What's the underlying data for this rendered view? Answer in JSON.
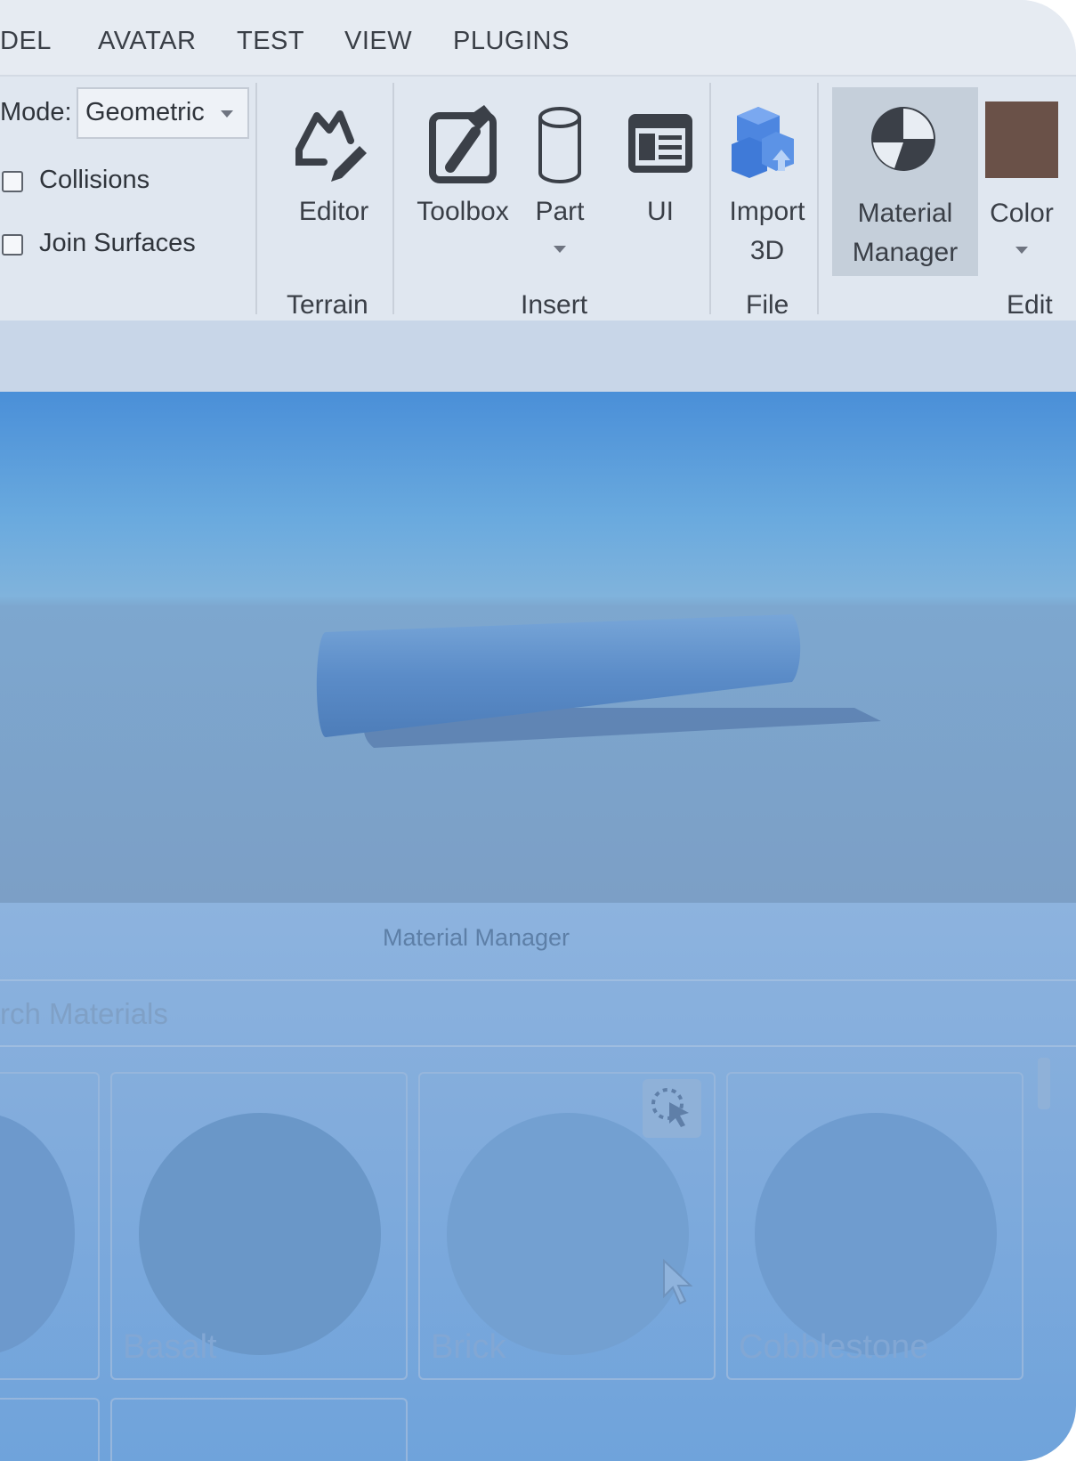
{
  "menu": {
    "items": [
      "DEL",
      "AVATAR",
      "TEST",
      "VIEW",
      "PLUGINS"
    ]
  },
  "terrain_settings": {
    "mode_label": "Mode:",
    "mode_value": "Geometric",
    "collisions_label": "Collisions",
    "join_surfaces_label": "Join Surfaces"
  },
  "ribbon": {
    "editor_label": "Editor",
    "toolbox_label": "Toolbox",
    "part_label": "Part",
    "ui_label": "UI",
    "import3d_label_1": "Import",
    "import3d_label_2": "3D",
    "material_manager_label_1": "Material",
    "material_manager_label_2": "Manager",
    "color_label": "Color",
    "group_terrain": "Terrain",
    "group_insert": "Insert",
    "group_file": "File",
    "group_edit": "Edit",
    "color_swatch": "#6a5148"
  },
  "material_manager": {
    "title": "Material Manager",
    "search_placeholder": "rch Materials",
    "materials": [
      "Basalt",
      "Brick",
      "Cobblestone"
    ]
  },
  "icons": [
    "editor-icon",
    "toolbox-icon",
    "part-icon",
    "ui-icon",
    "import-3d-icon",
    "material-manager-icon",
    "select-cursor-icon",
    "mouse-cursor-icon"
  ]
}
